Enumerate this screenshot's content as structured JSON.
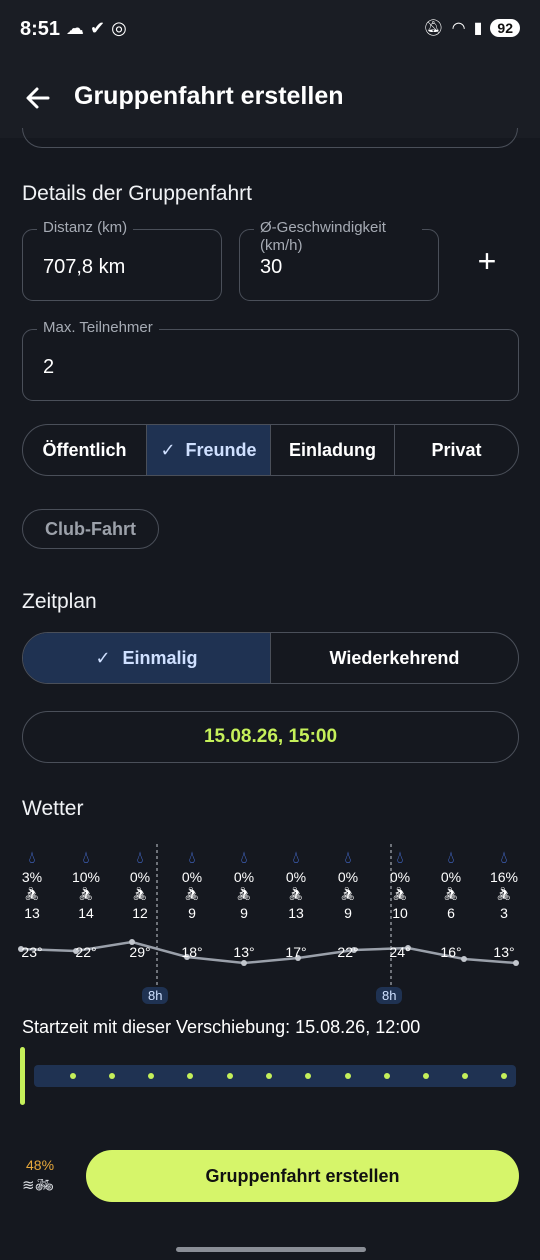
{
  "status_bar": {
    "time": "8:51",
    "battery": "92"
  },
  "app_bar": {
    "title": "Gruppenfahrt erstellen"
  },
  "details": {
    "section_title": "Details der Gruppenfahrt",
    "distance": {
      "label": "Distanz (km)",
      "value": "707,8 km"
    },
    "speed": {
      "label": "Ø-Geschwindigkeit (km/h)",
      "value": "30"
    },
    "max_participants": {
      "label": "Max. Teilnehmer",
      "value": "2"
    },
    "visibility_options": [
      "Öffentlich",
      "Freunde",
      "Einladung",
      "Privat"
    ],
    "visibility_selected": "Freunde",
    "club_chip": "Club-Fahrt"
  },
  "schedule": {
    "section_title": "Zeitplan",
    "options": [
      "Einmalig",
      "Wiederkehrend"
    ],
    "selected": "Einmalig",
    "datetime": "15.08.26, 15:00"
  },
  "weather": {
    "section_title": "Wetter",
    "columns": [
      {
        "rain": "3%",
        "wind": "13",
        "temp": "23°"
      },
      {
        "rain": "10%",
        "wind": "14",
        "temp": "22°"
      },
      {
        "rain": "0%",
        "wind": "12",
        "temp": "29°"
      },
      {
        "rain": "0%",
        "wind": "9",
        "temp": "18°"
      },
      {
        "rain": "0%",
        "wind": "9",
        "temp": "13°"
      },
      {
        "rain": "0%",
        "wind": "13",
        "temp": "17°"
      },
      {
        "rain": "0%",
        "wind": "9",
        "temp": "22°"
      },
      {
        "rain": "0%",
        "wind": "10",
        "temp": "24°"
      },
      {
        "rain": "0%",
        "wind": "6",
        "temp": "16°"
      },
      {
        "rain": "16%",
        "wind": "3",
        "temp": "13°"
      }
    ],
    "markers": [
      "8h",
      "8h"
    ]
  },
  "start_shift": {
    "text": "Startzeit mit dieser Verschiebung: 15.08.26, 12:00"
  },
  "footer": {
    "energy": "48%",
    "cta": "Gruppenfahrt erstellen"
  },
  "colors": {
    "accent": "#d6f56a",
    "selected": "#1f3252",
    "rain": "#4f7ef7",
    "background": "#15181f"
  },
  "icons": [
    "back-arrow-icon",
    "plus-icon",
    "check-icon",
    "water-drop-icon",
    "cyclist-icon",
    "wind-arrow-icon",
    "bike-icon"
  ]
}
